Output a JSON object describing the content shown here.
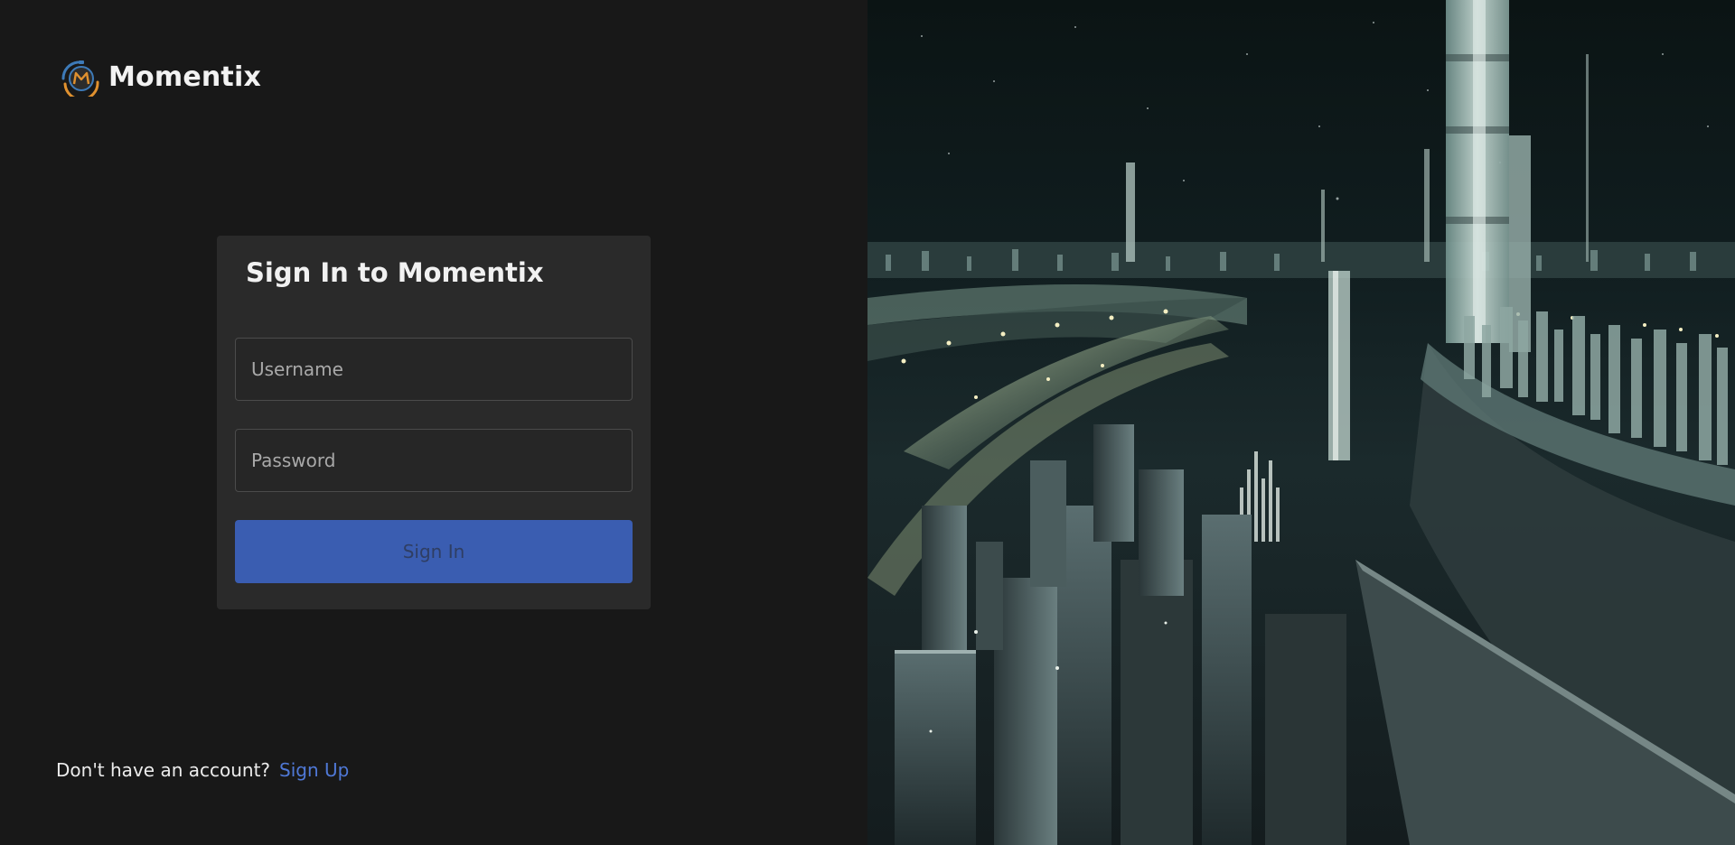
{
  "brand": {
    "name": "Momentix",
    "logo_icon": "clock-m-logo-icon"
  },
  "login": {
    "title": "Sign In to Momentix",
    "username_placeholder": "Username",
    "username_value": "",
    "password_placeholder": "Password",
    "password_value": "",
    "submit_label": "Sign In"
  },
  "signup": {
    "prompt": "Don't have an account?",
    "link_label": "Sign Up"
  },
  "hero": {
    "image_icon": "futuristic-city-illustration"
  },
  "colors": {
    "background": "#181818",
    "card": "#2a2a2a",
    "primary_button": "#3a5db1",
    "link": "#4f78d6",
    "logo_orange": "#e0912f",
    "logo_blue": "#3d7ab8"
  }
}
